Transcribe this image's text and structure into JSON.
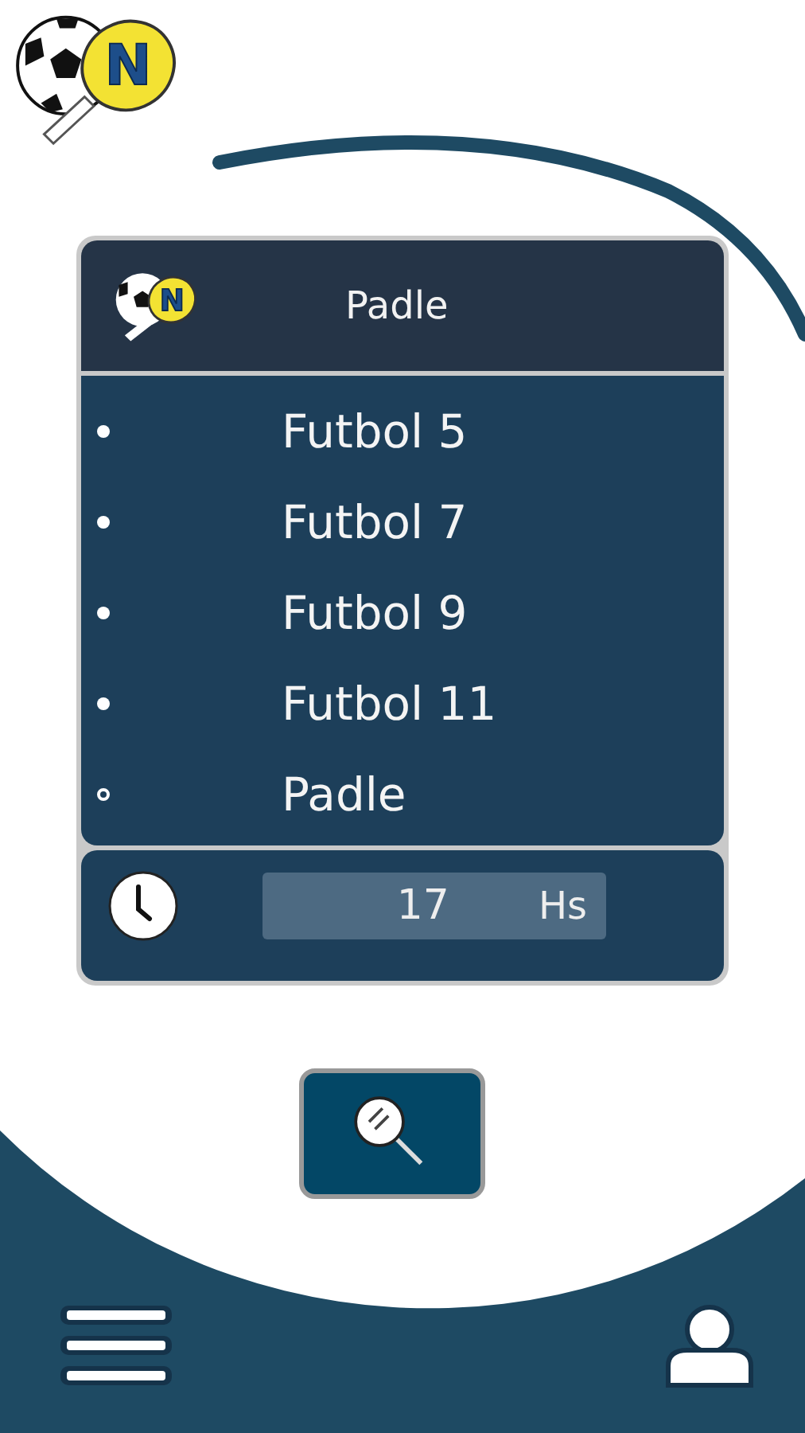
{
  "logo": {
    "letter": "N"
  },
  "card": {
    "logo_letter": "N",
    "title": "Padle"
  },
  "sports": [
    {
      "label": "Futbol 5",
      "selected": false
    },
    {
      "label": "Futbol 7",
      "selected": false
    },
    {
      "label": "Futbol 9",
      "selected": false
    },
    {
      "label": "Futbol 11",
      "selected": false
    },
    {
      "label": "Padle",
      "selected": true
    }
  ],
  "time": {
    "value": "17",
    "unit": "Hs"
  }
}
